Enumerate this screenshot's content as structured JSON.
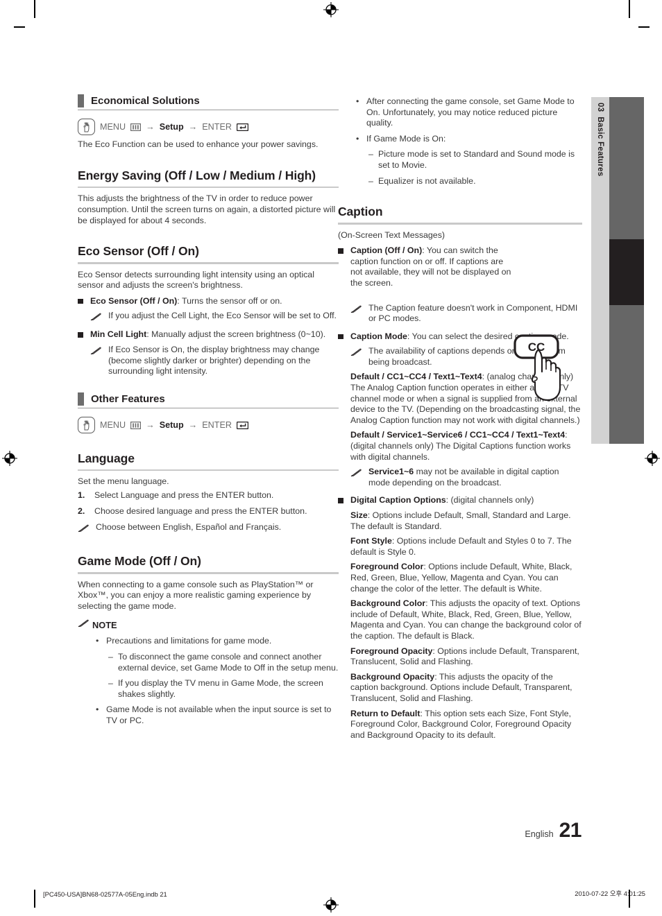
{
  "page": {
    "side_tab": {
      "number": "03",
      "title": "Basic Features"
    },
    "page_number": "21",
    "language_label": "English",
    "footer_left": "[PC450-USA]BN68-02577A-05Eng.indb   21",
    "footer_right": "2010-07-22   오후 4:01:25"
  },
  "icons": {
    "press": "hand-press-icon",
    "menu": "menu-bars-icon",
    "enter": "enter-return-icon",
    "note": "note-pencil-icon",
    "cc_button": "cc-remote-button-icon",
    "registration": "registration-mark"
  },
  "left_column": {
    "section_economical": {
      "heading": "Economical Solutions",
      "menu_path": {
        "menu": "MENU",
        "arrow": "→",
        "setup": "Setup",
        "enter": "ENTER"
      },
      "intro": "The Eco Function can be used to enhance your power savings."
    },
    "energy_saving": {
      "heading": "Energy Saving (Off / Low / Medium / High)",
      "body": "This adjusts the brightness of the TV in order to reduce power consumption. Until the screen turns on again, a distorted picture will be displayed for about 4 seconds."
    },
    "eco_sensor": {
      "heading": "Eco Sensor (Off / On)",
      "body": "Eco Sensor detects surrounding light intensity using an optical sensor and adjusts the screen's brightness.",
      "items": [
        {
          "label": "Eco Sensor (Off / On)",
          "text": ": Turns the sensor off or on.",
          "note": "If you adjust the Cell Light, the Eco Sensor will be set to Off."
        },
        {
          "label": "Min Cell Light",
          "text": ": Manually adjust the screen brightness (0~10).",
          "note": "If Eco Sensor is On, the display brightness may change (become slightly darker or brighter) depending on the surrounding light intensity."
        }
      ]
    },
    "section_other": {
      "heading": "Other Features",
      "menu_path": {
        "menu": "MENU",
        "arrow": "→",
        "setup": "Setup",
        "enter": "ENTER"
      }
    },
    "language": {
      "heading": "Language",
      "body": "Set the menu language.",
      "steps": [
        {
          "num": "1.",
          "text": "Select Language and press the ENTER button."
        },
        {
          "num": "2.",
          "text": "Choose desired language and press the ENTER button."
        }
      ],
      "note": "Choose between English, Español and Français."
    },
    "game_mode": {
      "heading": "Game Mode (Off / On)",
      "body": "When connecting to a game console such as PlayStation™ or Xbox™, you can enjoy a more realistic gaming experience by selecting the game mode.",
      "note_label": "NOTE",
      "notes": [
        {
          "text": "Precautions and limitations for game mode.",
          "subs": [
            "To disconnect the game console and connect another external device, set Game Mode to Off in the setup menu.",
            "If you display the TV menu in Game Mode, the screen shakes slightly."
          ]
        },
        {
          "text": "Game Mode is not available when the input source is set to TV or PC.",
          "subs": []
        }
      ]
    }
  },
  "right_column": {
    "game_mode_continued": [
      {
        "text": "After connecting the game console, set Game Mode to On. Unfortunately, you may notice reduced picture quality.",
        "subs": []
      },
      {
        "text": "If Game Mode is On:",
        "subs": [
          "Picture mode is set to Standard and Sound mode is set to Movie.",
          "Equalizer is not available."
        ]
      }
    ],
    "caption": {
      "heading": "Caption",
      "subtitle": "(On-Screen Text Messages)",
      "cc_button_label": "CC",
      "item_caption": {
        "label": "Caption (Off / On)",
        "text": ": You can switch the caption function on or off. If captions are not available, they will not be displayed on the screen.",
        "note": "The Caption feature doesn't work in Component, HDMI or PC modes."
      },
      "item_caption_mode": {
        "label": "Caption Mode",
        "text": ": You can select the desired caption mode.",
        "note": "The availability of captions depends on the program being broadcast.",
        "analog_label": "Default / CC1~CC4 / Text1~Text4",
        "analog_text": ": (analog channels only) The Analog Caption function operates in either analog TV channel mode or when a signal is supplied from an external device to the TV. (Depending on the broadcasting signal, the Analog Caption function may not work with digital channels.)",
        "digital_label": "Default / Service1~Service6 / CC1~CC4 / Text1~Text4",
        "digital_text": ": (digital channels only) The Digital Captions function works with digital channels.",
        "digital_note_label": "Service1~6",
        "digital_note_text": " may not be available in digital caption mode depending on the broadcast."
      },
      "item_digital_options": {
        "label": "Digital Caption Options",
        "text": ": (digital channels only)",
        "options": [
          {
            "label": "Size",
            "text": ": Options include Default, Small, Standard and Large. The default is Standard."
          },
          {
            "label": "Font Style",
            "text": ": Options include Default and Styles 0 to 7. The default is Style 0."
          },
          {
            "label": "Foreground Color",
            "text": ": Options include Default, White, Black, Red, Green, Blue, Yellow, Magenta and Cyan. You can change the color of the letter. The default is White."
          },
          {
            "label": "Background Color",
            "text": ": This adjusts the opacity of text. Options include of Default, White, Black, Red, Green, Blue, Yellow, Magenta and Cyan. You can change the background color of the caption. The default is Black."
          },
          {
            "label": "Foreground Opacity",
            "text": ": Options include Default, Transparent, Translucent, Solid and Flashing."
          },
          {
            "label": "Background Opacity",
            "text": ": This adjusts the opacity of the caption background. Options include Default, Transparent, Translucent, Solid and Flashing."
          },
          {
            "label": "Return to Default",
            "text": ": This option sets each Size, Font Style, Foreground Color, Background Color, Foreground Opacity and Background Opacity to its default."
          }
        ]
      }
    }
  }
}
